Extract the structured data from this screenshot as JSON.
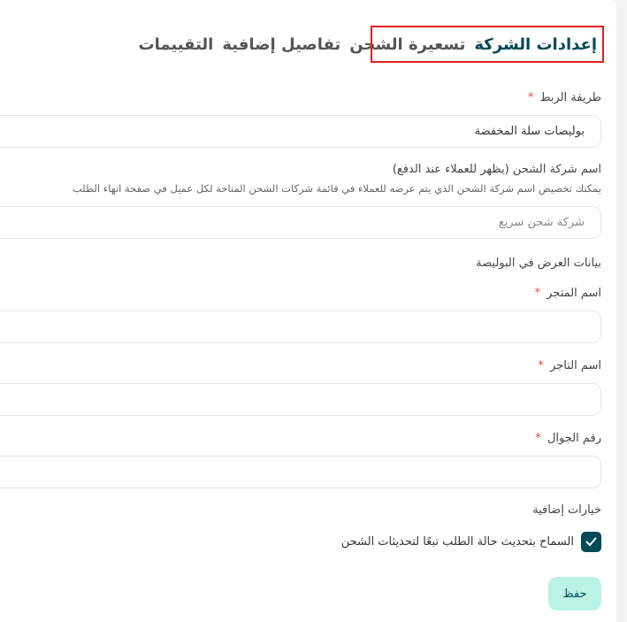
{
  "tabs": [
    {
      "label": "إعدادات الشركة",
      "active": true
    },
    {
      "label": "تسعيرة الشحن",
      "active": false
    },
    {
      "label": "تفاصيل إضافية",
      "active": false
    },
    {
      "label": "التقييمات",
      "active": false
    }
  ],
  "form": {
    "link_method": {
      "label": "طريقة الربط",
      "required_mark": "*",
      "value": "بوليصات سلة المخفضة"
    },
    "carrier_name": {
      "label": "اسم شركة الشحن (يظهر للعملاء عند الدفع)",
      "helper": "يمكنك تخصيص اسم شركة الشحن الذي يتم عرضه للعملاء في قائمة شركات الشحن المتاحة لكل عميل في صفحة انهاء الطلب",
      "placeholder": "شركة شحن سريع",
      "value": ""
    },
    "section_title": "بيانات العرض في البوليصة",
    "store_name": {
      "label": "اسم المتجر",
      "required_mark": "*",
      "value": ""
    },
    "merchant_name": {
      "label": "اسم التاجر",
      "required_mark": "*",
      "value": ""
    },
    "mobile": {
      "label": "رقم الجوال",
      "required_mark": "*",
      "value": ""
    },
    "extra_options_title": "خيارات إضافية",
    "allow_status_update": {
      "label": "السماح بتحديث حالة الطلب تبعًا لتحديثات الشحن",
      "checked": true
    }
  },
  "save_button": {
    "label": "حفظ"
  },
  "colors": {
    "accent": "#004956",
    "highlight_border": "#e02020",
    "save_bg": "#baf3e6",
    "required": "#e74c3c"
  }
}
